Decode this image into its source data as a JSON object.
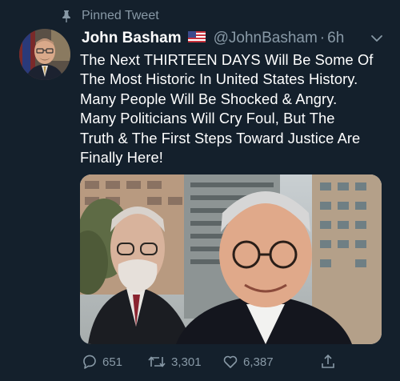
{
  "pinned": {
    "label": "Pinned Tweet",
    "icon": "pin-icon"
  },
  "author": {
    "name": "John Basham",
    "flag_icon": "us-flag-icon",
    "handle": "@JohnBasham",
    "separator": "·",
    "time": "6h"
  },
  "tweet": {
    "lines": [
      "The Next THIRTEEN DAYS Will Be Some Of",
      "The Most Historic In United States History.",
      "Many People Will Be Shocked & Angry.",
      "Many Politicians Will Cry Foul, But The",
      "Truth & The First Steps Toward Justice Are",
      "Finally Here!"
    ]
  },
  "actions": {
    "replies": "651",
    "retweets": "3,301",
    "likes": "6,387"
  },
  "colors": {
    "background": "#14202c",
    "muted": "#8899a6",
    "text": "#ffffff"
  }
}
